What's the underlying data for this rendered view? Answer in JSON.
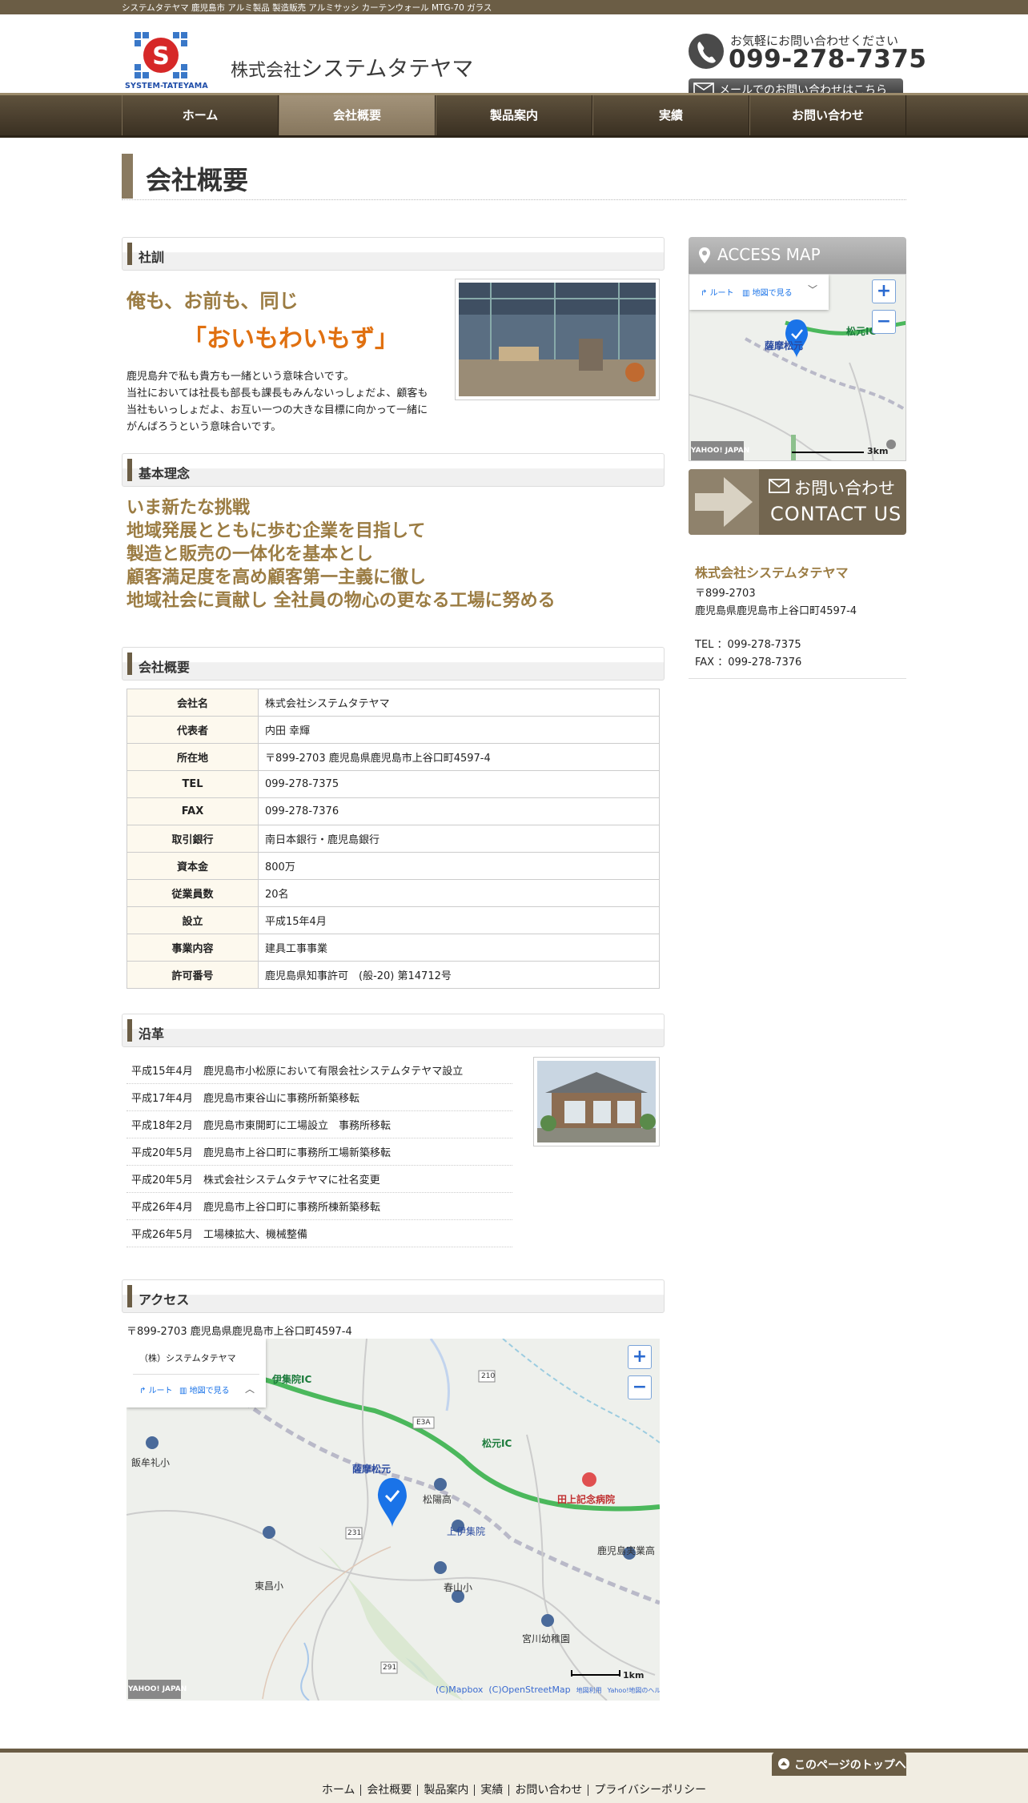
{
  "topbar": {
    "text": "システムタテヤマ 鹿児島市 アルミ製品 製造販売 アルミサッシ カーテンウォール MTG-70 ガラス"
  },
  "header": {
    "logo_text": "SYSTEM-TATEYAMA",
    "company_prefix": "株式会社",
    "company_name": "システムタテヤマ",
    "phone_lead": "お気軽にお問い合わせください",
    "phone_number": "099-278-7375",
    "mail_button": "メールでのお問い合わせはこちら"
  },
  "nav": {
    "items": [
      "ホーム",
      "会社概要",
      "製品案内",
      "実績",
      "お問い合わせ"
    ],
    "active": 1
  },
  "page": {
    "title": "会社概要"
  },
  "motto": {
    "heading": "社訓",
    "line1": "俺も、お前も、同じ",
    "line2": "「おいもわいもず」",
    "text": "鹿児島弁で私も貴方も一緒という意味合いです。\n当社においては社長も部長も課長もみんないっしょだよ、顧客も当社もいっしょだよ、お互い一つの大きな目標に向かって一緒にがんばろうという意味合いです。"
  },
  "philosophy": {
    "heading": "基本理念",
    "lines": [
      "いま新たな挑戦",
      "地域発展とともに歩む企業を目指して",
      "製造と販売の一体化を基本とし",
      "顧客満足度を高め顧客第一主義に徹し",
      "地域社会に貢献し 全社員の物心の更なる工場に努める"
    ]
  },
  "profile": {
    "heading": "会社概要",
    "rows": [
      {
        "key": "会社名",
        "value": "株式会社システムタテヤマ"
      },
      {
        "key": "代表者",
        "value": "内田 幸輝"
      },
      {
        "key": "所在地",
        "value": "〒899-2703 鹿児島県鹿児島市上谷口町4597-4"
      },
      {
        "key": "TEL",
        "value": "099-278-7375"
      },
      {
        "key": "FAX",
        "value": "099-278-7376"
      },
      {
        "key": "取引銀行",
        "value": "南日本銀行・鹿児島銀行"
      },
      {
        "key": "資本金",
        "value": "800万"
      },
      {
        "key": "従業員数",
        "value": "20名"
      },
      {
        "key": "設立",
        "value": "平成15年4月"
      },
      {
        "key": "事業内容",
        "value": "建具工事事業"
      },
      {
        "key": "許可番号",
        "value": "鹿児島県知事許可　(般-20) 第14712号"
      }
    ]
  },
  "history": {
    "heading": "沿革",
    "rows": [
      {
        "date": "平成15年4月",
        "event": "鹿児島市小松原において有限会社システムタテヤマ設立"
      },
      {
        "date": "平成17年4月",
        "event": "鹿児島市東谷山に事務所新築移転"
      },
      {
        "date": "平成18年2月",
        "event": "鹿児島市東開町に工場設立　事務所移転"
      },
      {
        "date": "平成20年5月",
        "event": "鹿児島市上谷口町に事務所工場新築移転"
      },
      {
        "date": "平成20年5月",
        "event": "株式会社システムタテヤマに社名変更"
      },
      {
        "date": "平成26年4月",
        "event": "鹿児島市上谷口町に事務所棟新築移転"
      },
      {
        "date": "平成26年5月",
        "event": "工場棟拡大、機械整備"
      }
    ]
  },
  "access": {
    "heading": "アクセス",
    "address": "〒899-2703 鹿児島県鹿児島市上谷口町4597-4",
    "map_popup": "（株）システムタテヤマ",
    "route_label": "ルート",
    "map_link": "地図で見る",
    "scale": "1km",
    "brand": "YAHOO! JAPAN",
    "credits": [
      "(C)Mapbox",
      "(C)OpenStreetMap",
      "地図利用",
      "Yahoo!地図のヘルプ"
    ],
    "labels": [
      "伊集院IC",
      "松元IC",
      "薩摩松元",
      "松陽高",
      "上伊集院",
      "飯牟礼小",
      "東昌小",
      "春山小",
      "田上記念病院",
      "鹿児島実業高",
      "宮川幼稚園",
      "E3A",
      "210",
      "231",
      "291"
    ]
  },
  "sidebar": {
    "access_map_title": "ACCESS MAP",
    "map_labels": [
      "薩摩松元",
      "松元IC"
    ],
    "map_scale": "3km",
    "map_brand": "YAHOO! JAPAN",
    "contact_jp": "お問い合わせ",
    "contact_en": "CONTACT US",
    "company": "株式会社システムタテヤマ",
    "zip": "〒899-2703",
    "address": "鹿児島県鹿児島市上谷口町4597-4",
    "tel": "TEL ：099-278-7375",
    "fax": "FAX ：099-278-7376"
  },
  "footer": {
    "to_top": "このページのトップへ",
    "links": [
      "ホーム",
      "会社概要",
      "製品案内",
      "実績",
      "お問い合わせ",
      "プライバシーポリシー"
    ]
  },
  "colors": {
    "brand_brown": "#6b5d45",
    "accent_gold": "#9b7c43",
    "accent_orange": "#e07010",
    "map_pin": "#1a73e8"
  }
}
